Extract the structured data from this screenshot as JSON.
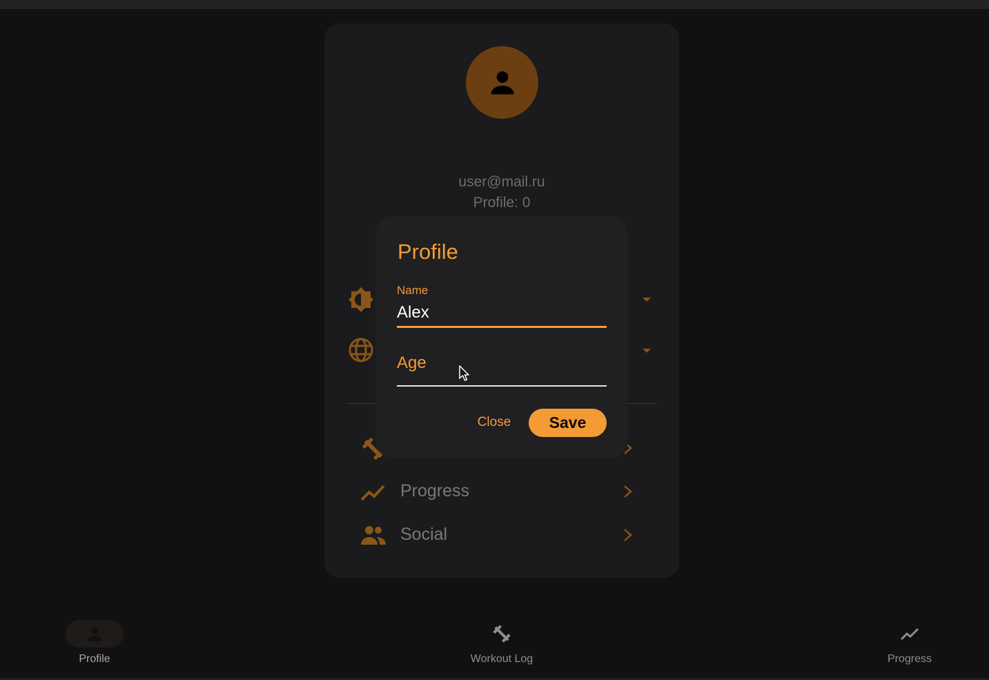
{
  "profile_card": {
    "email": "user@mail.ru",
    "profile_count": "Profile:  0",
    "menu": [
      {
        "label": "",
        "icon": "dumbbell-icon"
      },
      {
        "label": "Progress",
        "icon": "trending-up-icon"
      },
      {
        "label": "Social",
        "icon": "people-icon"
      }
    ]
  },
  "dialog": {
    "title": "Profile",
    "name_label": "Name",
    "name_value": "Alex",
    "age_placeholder": "Age",
    "close_label": "Close",
    "save_label": "Save"
  },
  "bottom_nav": {
    "items": [
      {
        "label": "Profile",
        "icon": "person-icon",
        "active": true
      },
      {
        "label": "Workout Log",
        "icon": "dumbbell-icon",
        "active": false
      },
      {
        "label": "Progress",
        "icon": "trending-up-icon",
        "active": false
      }
    ]
  },
  "colors": {
    "accent": "#f49b36",
    "background": "#121112",
    "card": "#1b1a1c",
    "dialog": "#201f21"
  }
}
